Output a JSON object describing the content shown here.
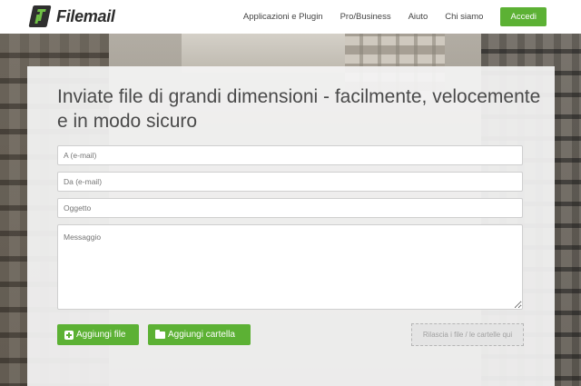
{
  "header": {
    "logo_text": "Filemail",
    "nav": [
      "Applicazioni e Plugin",
      "Pro/Business",
      "Aiuto",
      "Chi siamo"
    ],
    "login_label": "Accedi"
  },
  "main": {
    "headline": "Inviate file di grandi dimensioni - facilmente, velocemente e in modo sicuro",
    "fields": {
      "to_placeholder": "A (e-mail)",
      "from_placeholder": "Da (e-mail)",
      "subject_placeholder": "Oggetto",
      "message_placeholder": "Messaggio"
    },
    "buttons": {
      "add_files": "Aggiungi file",
      "add_folder": "Aggiungi cartella"
    },
    "dropzone_text": "Rilascia i file / le cartelle qui"
  },
  "colors": {
    "accent": "#5cb134",
    "text": "#4a4a4a"
  },
  "icons": [
    "filemail-logo-icon",
    "plus-icon",
    "folder-icon"
  ]
}
